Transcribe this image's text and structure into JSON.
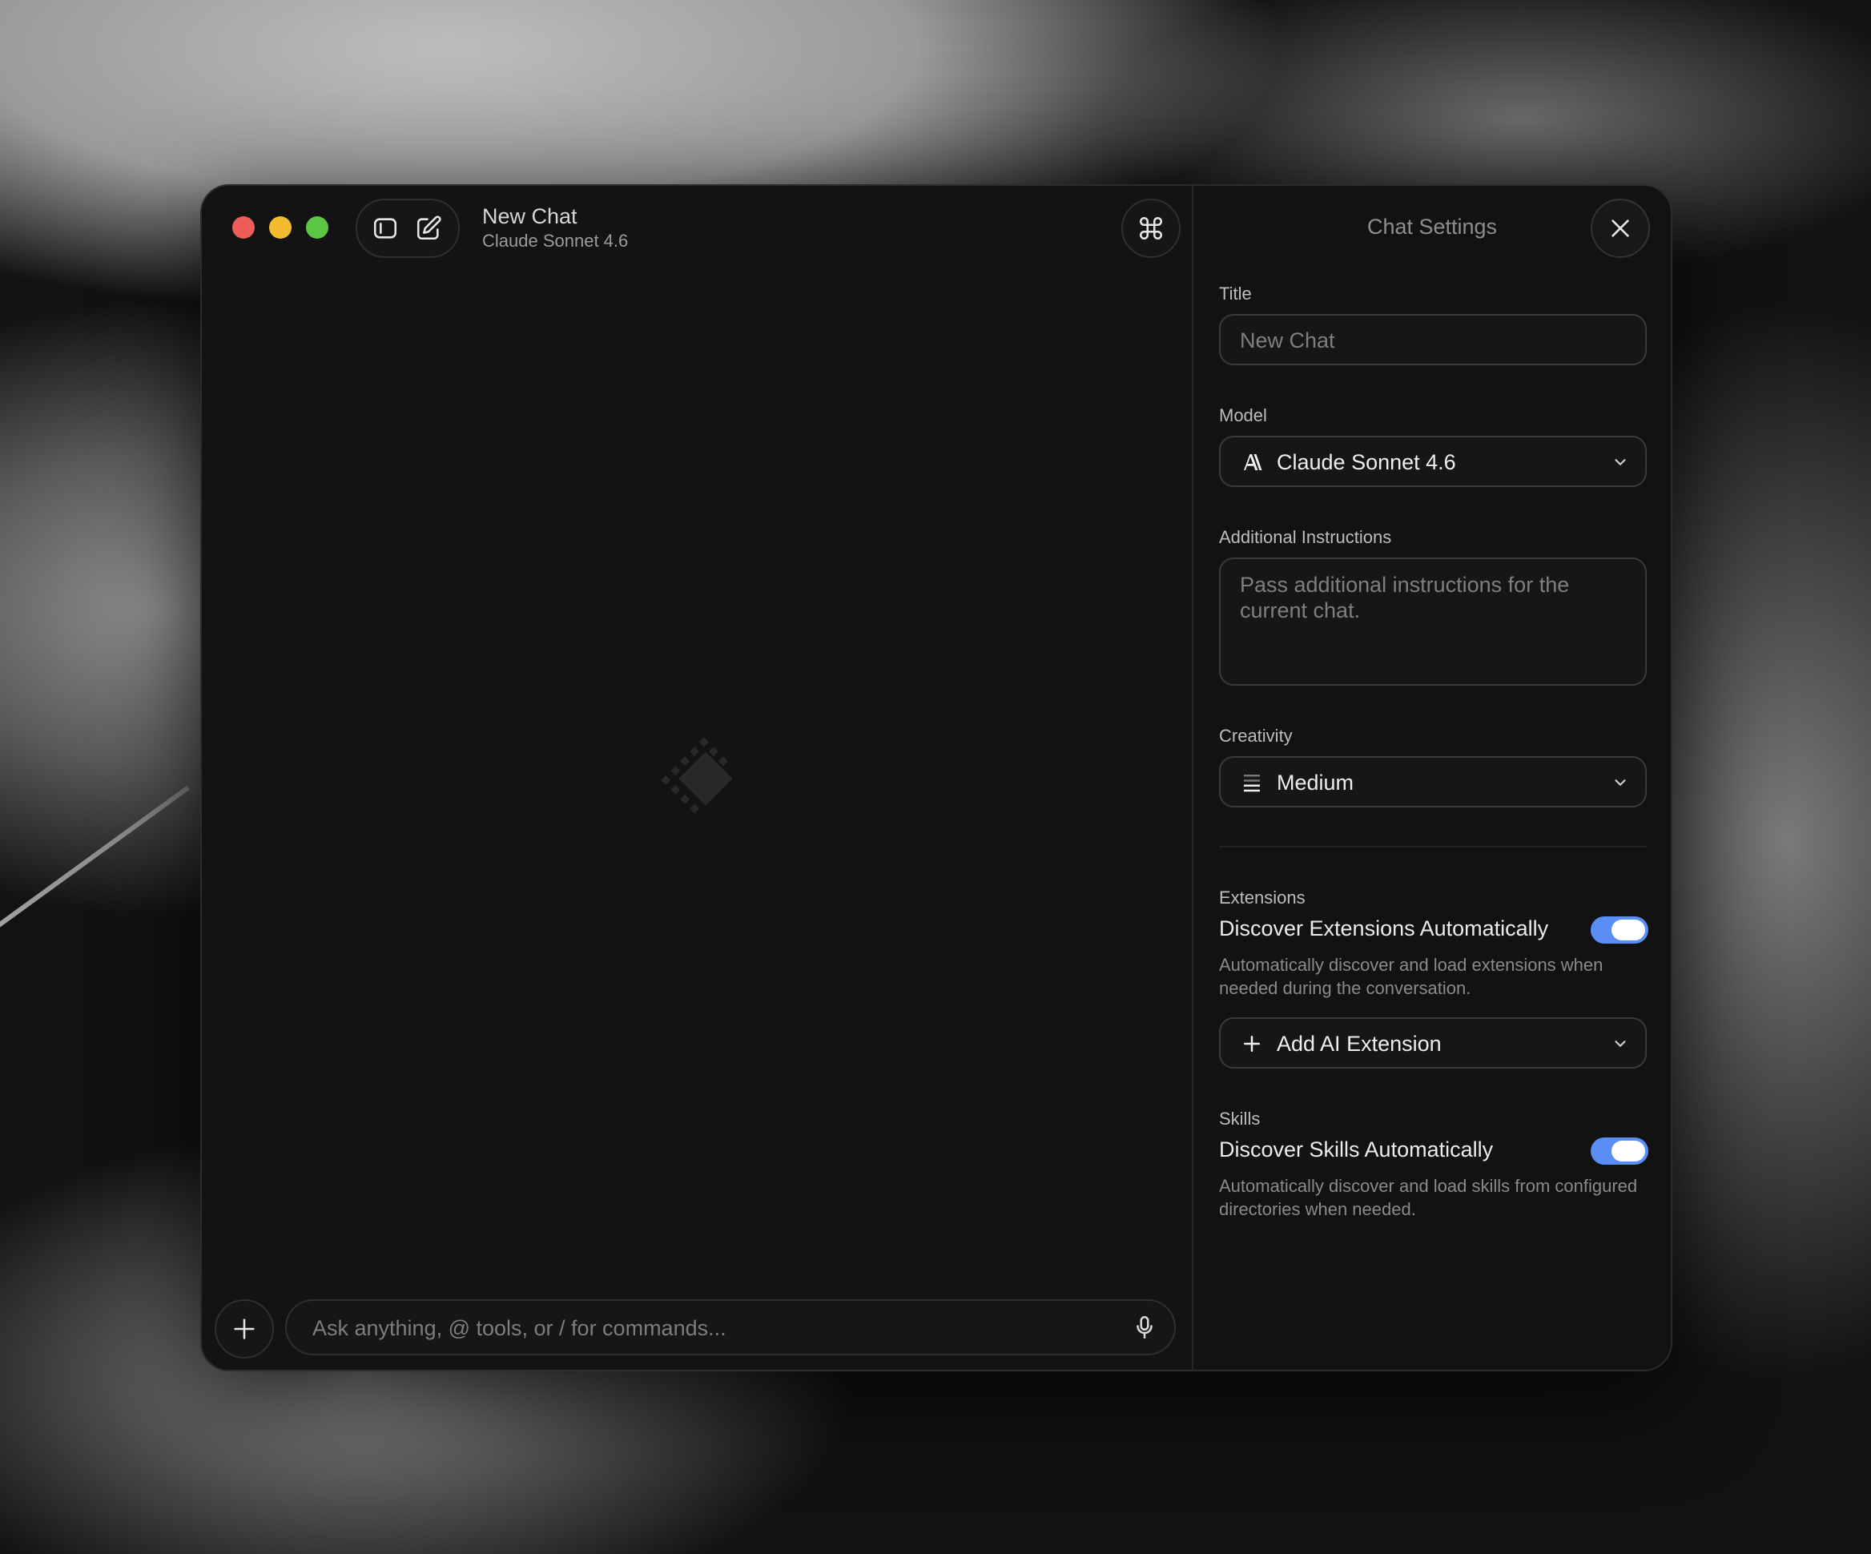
{
  "window": {
    "chat_title": "New Chat",
    "chat_subtitle": "Claude Sonnet 4.6"
  },
  "icons": {
    "sidebar": "sidebar-toggle-icon",
    "new_chat": "compose-icon",
    "command": "command-icon",
    "logo": "app-logo-icon",
    "add": "plus-icon",
    "mic": "microphone-icon",
    "close": "close-icon"
  },
  "composer": {
    "placeholder": "Ask anything, @ tools, or / for commands..."
  },
  "settings": {
    "header": "Chat Settings",
    "title_label": "Title",
    "title_placeholder": "New Chat",
    "model_label": "Model",
    "model_value": "Claude Sonnet 4.6",
    "instructions_label": "Additional Instructions",
    "instructions_placeholder": "Pass additional instructions for the current chat.",
    "creativity_label": "Creativity",
    "creativity_value": "Medium",
    "extensions_label": "Extensions",
    "extensions_toggle_title": "Discover Extensions Automatically",
    "extensions_toggle_on": true,
    "extensions_desc": "Automatically discover and load extensions when needed during the conversation.",
    "add_extension_label": "Add AI Extension",
    "skills_label": "Skills",
    "skills_toggle_title": "Discover Skills Automatically",
    "skills_toggle_on": true,
    "skills_desc": "Automatically discover and load skills from configured directories when needed."
  },
  "colors": {
    "accent_toggle": "#5a8ef5",
    "traffic_red": "#ee5d59",
    "traffic_yellow": "#f3bc2e",
    "traffic_green": "#5cc645"
  }
}
